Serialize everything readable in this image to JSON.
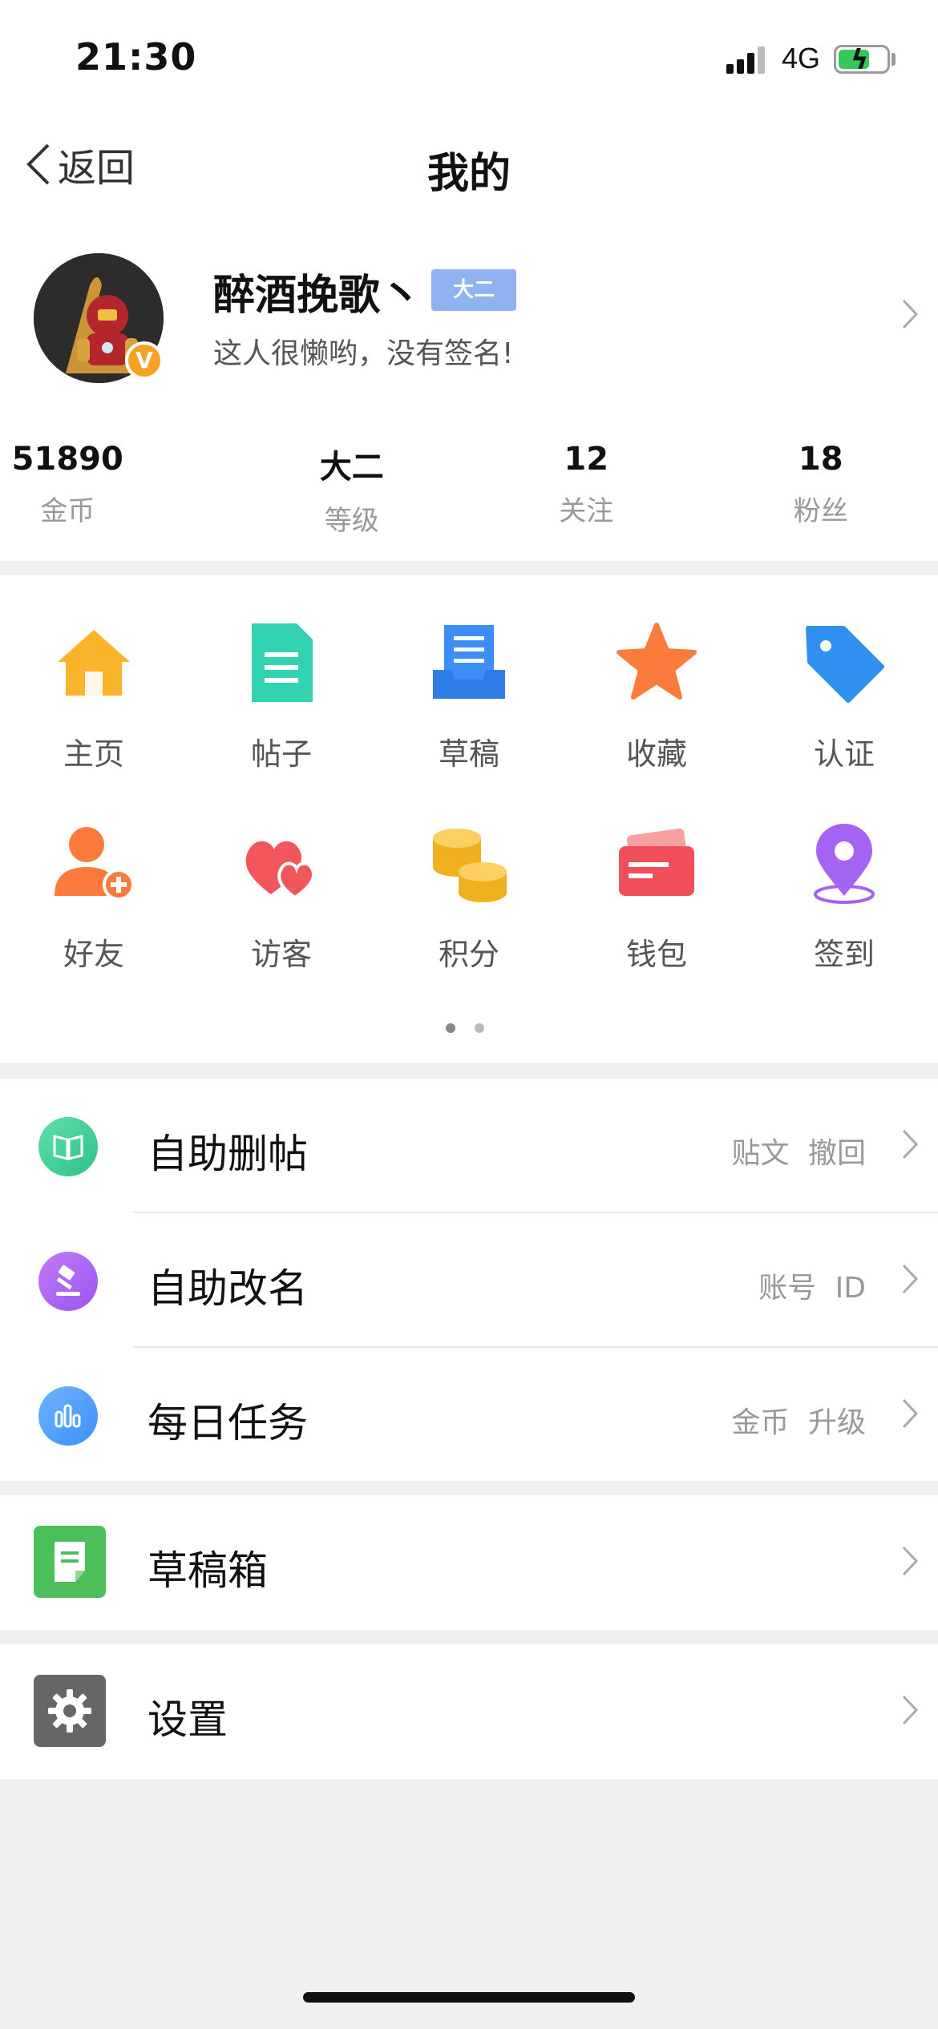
{
  "status_bar": {
    "time": "21:30",
    "network": "4G"
  },
  "nav": {
    "back_label": "返回",
    "title": "我的"
  },
  "profile": {
    "name": "醉酒挽歌丶",
    "level_tag": "大二",
    "signature": "这人很懒哟，没有签名!",
    "badge": "V"
  },
  "stats": [
    {
      "value": "51890",
      "label": "金币"
    },
    {
      "value": "大二",
      "label": "等级"
    },
    {
      "value": "12",
      "label": "关注"
    },
    {
      "value": "18",
      "label": "粉丝"
    }
  ],
  "grid": [
    {
      "label": "主页",
      "icon": "home-icon"
    },
    {
      "label": "帖子",
      "icon": "document-icon"
    },
    {
      "label": "草稿",
      "icon": "inbox-icon"
    },
    {
      "label": "收藏",
      "icon": "star-icon"
    },
    {
      "label": "认证",
      "icon": "tag-icon"
    },
    {
      "label": "好友",
      "icon": "add-friend-icon"
    },
    {
      "label": "访客",
      "icon": "hearts-icon"
    },
    {
      "label": "积分",
      "icon": "coins-icon"
    },
    {
      "label": "钱包",
      "icon": "wallet-icon"
    },
    {
      "label": "签到",
      "icon": "location-pin-icon"
    }
  ],
  "pagination": {
    "pages": 2,
    "current": 1
  },
  "list": [
    {
      "label": "自助删帖",
      "meta": "贴文 撤回",
      "icon": "book-icon",
      "color": "#3ecf8e"
    },
    {
      "label": "自助改名",
      "meta": "账号 ID",
      "icon": "gavel-icon",
      "color": "#a463f2"
    },
    {
      "label": "每日任务",
      "meta": "金币 升级",
      "icon": "bar-chart-icon",
      "color": "#3d8ef8"
    }
  ],
  "drafts": {
    "label": "草稿箱",
    "icon": "draft-box-icon",
    "color": "#4cbf5a"
  },
  "settings": {
    "label": "设置",
    "icon": "gear-icon",
    "color": "#666666"
  }
}
